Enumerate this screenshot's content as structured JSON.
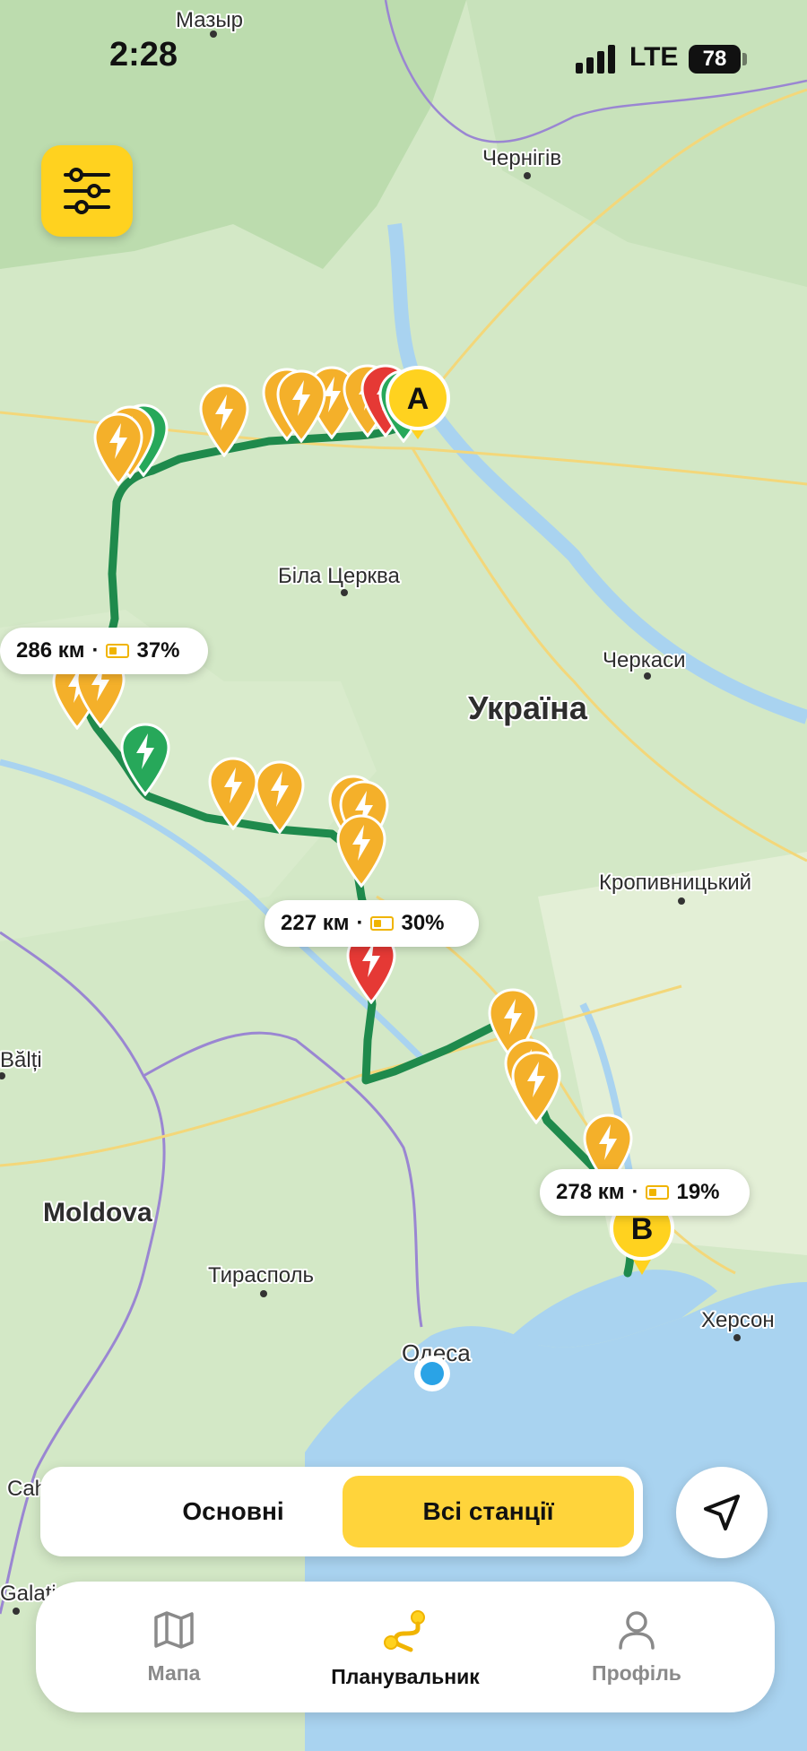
{
  "status_bar": {
    "time": "2:28",
    "network": "LTE",
    "battery": "78"
  },
  "map": {
    "cities": {
      "mazyr": "Мазыр",
      "chernihiv": "Чернігів",
      "bila_tserkva": "Біла Церква",
      "cherkasy": "Черкаси",
      "ukraine": "Україна",
      "kropyvnytskyi": "Кропивницький",
      "moldova": "Moldova",
      "tiraspol": "Тирасполь",
      "odesa": "Одеса",
      "kherson": "Херсон",
      "balti": "Bălți",
      "cahul": "Cahul",
      "galati": "Galați"
    },
    "markers": {
      "start": "A",
      "end": "B"
    },
    "legs": [
      {
        "distance": "286 км",
        "sep": "·",
        "battery": "37%"
      },
      {
        "distance": "227 км",
        "sep": "·",
        "battery": "30%"
      },
      {
        "distance": "278 км",
        "sep": "·",
        "battery": "19%"
      }
    ],
    "colors": {
      "route": "#1f8a4c",
      "charger": "#f4b02a",
      "charger_free": "#27a85a",
      "charger_busy": "#e53935",
      "marker": "#ffd21f",
      "water": "#a9d3f0"
    }
  },
  "toggle": {
    "main": "Основні",
    "all": "Всі станції"
  },
  "tabs": {
    "map": "Мапа",
    "planner": "Планувальник",
    "profile": "Профіль"
  },
  "icons": {
    "filter": "sliders-icon",
    "navigate": "navigation-arrow-icon",
    "map": "map-icon",
    "planner": "route-icon",
    "profile": "person-icon"
  }
}
